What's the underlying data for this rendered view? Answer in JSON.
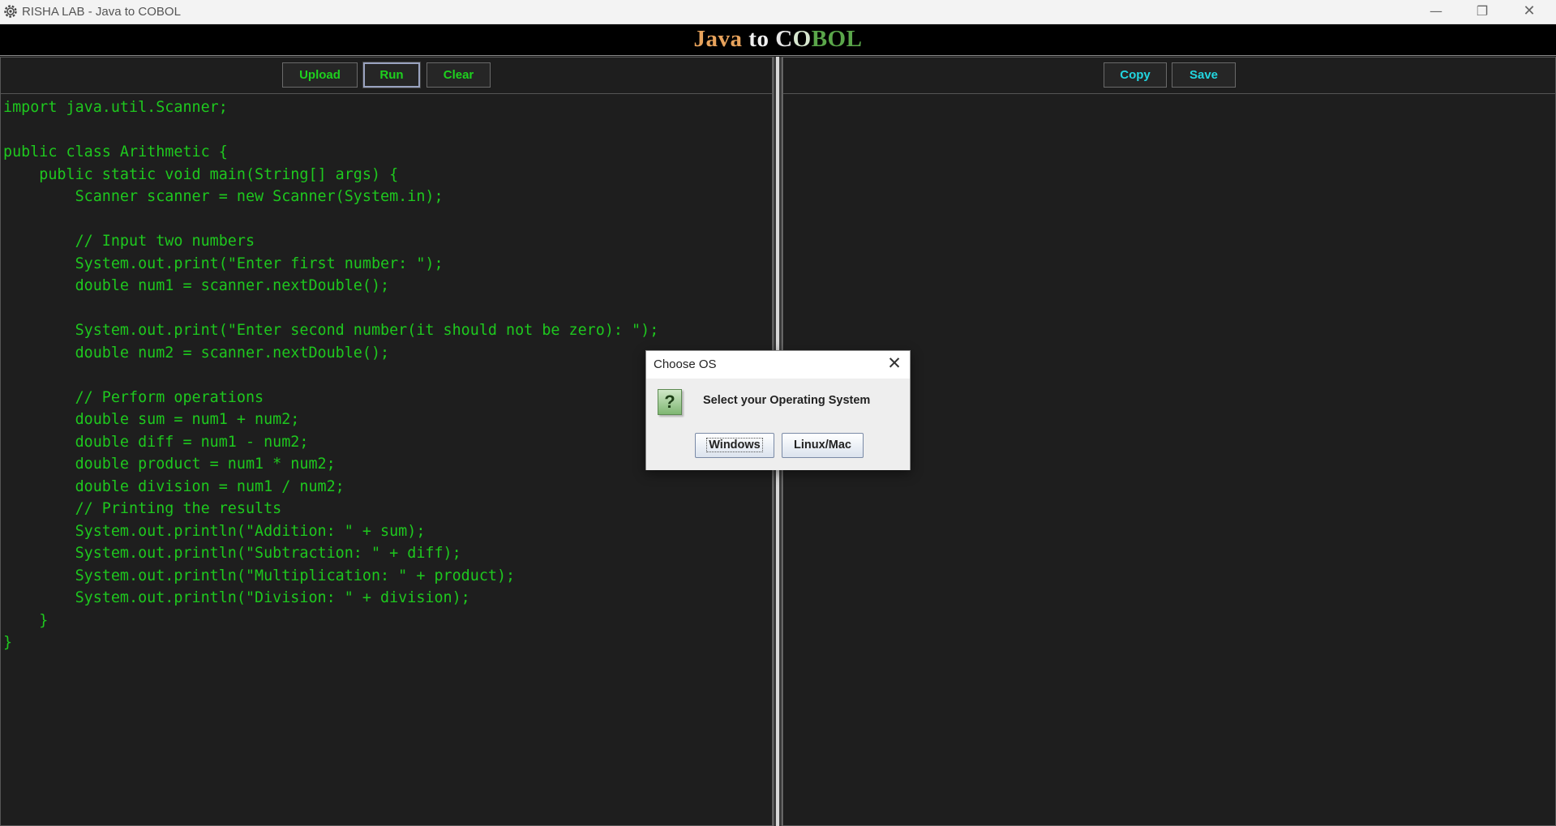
{
  "window": {
    "title": "RISHA LAB - Java to COBOL",
    "minimize_glyph": "—",
    "restore_glyph": "❐",
    "close_glyph": "✕",
    "app_icon": "settings-gear-icon"
  },
  "banner": {
    "title_java": "Java",
    "title_to": "to",
    "title_c": "C",
    "title_o": "O",
    "title_bol": "BOL",
    "colors": {
      "java": "#e8a35c",
      "to": "#f0f0f0",
      "bol": "#5aa64a"
    }
  },
  "left_panel": {
    "buttons": {
      "upload": "Upload",
      "run": "Run",
      "clear": "Clear"
    },
    "code": "import java.util.Scanner;\n\npublic class Arithmetic {\n    public static void main(String[] args) {\n        Scanner scanner = new Scanner(System.in);\n\n        // Input two numbers\n        System.out.print(\"Enter first number: \");\n        double num1 = scanner.nextDouble();\n\n        System.out.print(\"Enter second number(it should not be zero): \");\n        double num2 = scanner.nextDouble();\n\n        // Perform operations\n        double sum = num1 + num2;\n        double diff = num1 - num2;\n        double product = num1 * num2;\n        double division = num1 / num2;\n        // Printing the results\n        System.out.println(\"Addition: \" + sum);\n        System.out.println(\"Subtraction: \" + diff);\n        System.out.println(\"Multiplication: \" + product);\n        System.out.println(\"Division: \" + division);\n    }\n}"
  },
  "right_panel": {
    "buttons": {
      "copy": "Copy",
      "save": "Save"
    },
    "output": ""
  },
  "dialog": {
    "title": "Choose OS",
    "close_glyph": "✕",
    "icon": "question-icon",
    "icon_glyph": "?",
    "message": "Select your Operating System",
    "buttons": {
      "windows": "Windows",
      "linux_mac": "Linux/Mac"
    }
  },
  "colors": {
    "code_text": "#1ec81e",
    "green_button_text": "#1ed11e",
    "cyan_button_text": "#22d6e0",
    "panel_background": "#1e1e1e"
  }
}
